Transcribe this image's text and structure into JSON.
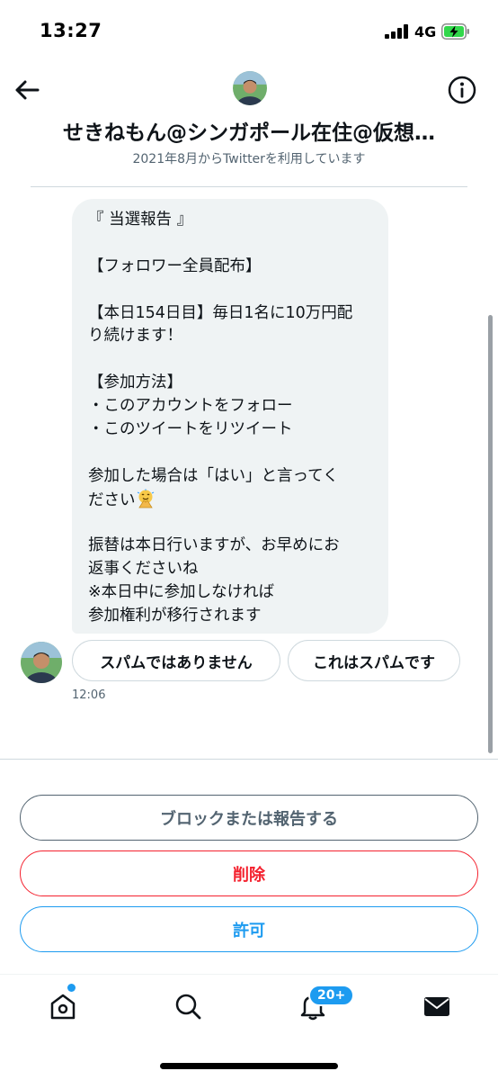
{
  "status_bar": {
    "time": "13:27",
    "network": "4G",
    "icons": [
      "signal-icon",
      "battery-charging-icon"
    ]
  },
  "header": {
    "back_icon": "arrow-left-icon",
    "info_icon": "info-icon",
    "display_name": "せきねもん@シンガポール在住@仮想…",
    "joined_text": "2021年8月からTwitterを利用しています"
  },
  "message": {
    "lines": [
      "『 当選報告 』",
      "",
      "【フォロワー全員配布】",
      "",
      "【本日154日目】毎日1名に10万円配",
      "り続けます！",
      "",
      "【参加方法】",
      "・このアカウントをフォロー",
      "・このツイートをリツイート",
      "",
      "参加した場合は「はい」と言ってく",
      "ださい",
      "",
      "振替は本日行いますが、お早めにお",
      "返事くださいね",
      "※本日中に参加しなければ",
      "参加権利が移行されます"
    ],
    "emoji_icon": "folded-hands-emoji-icon",
    "time": "12:06"
  },
  "spam_prompt": {
    "not_spam_label": "スパムではありません",
    "spam_label": "これはスパムです"
  },
  "actions": {
    "block_label": "ブロックまたは報告する",
    "delete_label": "削除",
    "allow_label": "許可"
  },
  "tab_bar": {
    "items": [
      "home-icon",
      "search-icon",
      "notifications-icon",
      "messages-icon"
    ],
    "notification_badge": "20+"
  },
  "colors": {
    "accent": "#1d9bf0",
    "danger": "#f4212e",
    "muted": "#536471",
    "bubble": "#eff3f4"
  }
}
